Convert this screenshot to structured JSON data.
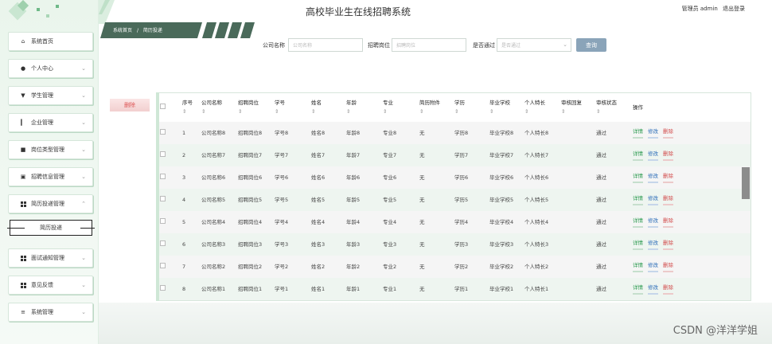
{
  "app": {
    "title": "高校毕业生在线招聘系统"
  },
  "header": {
    "user_text": "管理员 admin",
    "logout": "退出登录"
  },
  "breadcrumb": {
    "home": "系统首页",
    "sep": "/",
    "current": "简历投递"
  },
  "sidebar": {
    "items": [
      {
        "label": "系统首页",
        "icon": "home-icon"
      },
      {
        "label": "个人中心",
        "icon": "user-icon"
      },
      {
        "label": "学生管理",
        "icon": "student-icon"
      },
      {
        "label": "企业管理",
        "icon": "bar-chart-icon"
      },
      {
        "label": "岗位类型管理",
        "icon": "book-icon"
      },
      {
        "label": "招聘信息管理",
        "icon": "clipboard-icon"
      },
      {
        "label": "简历投递管理",
        "icon": "grid-icon"
      },
      {
        "label": "面试通知管理",
        "icon": "grid-icon"
      },
      {
        "label": "意见反馈",
        "icon": "grid-icon"
      },
      {
        "label": "系统管理",
        "icon": "sliders-icon"
      }
    ],
    "sub_item": "简历投递"
  },
  "search": {
    "company_label": "公司名称",
    "company_placeholder": "公司名称",
    "position_label": "招聘岗位",
    "position_placeholder": "招聘岗位",
    "approved_label": "是否通过",
    "approved_placeholder": "是否通过",
    "query_button": "查询"
  },
  "delete_button": "删除",
  "table": {
    "headers": [
      "序号",
      "公司名称",
      "招聘岗位",
      "学号",
      "姓名",
      "年龄",
      "专业",
      "简历附件",
      "学历",
      "毕业学校",
      "个人特长",
      "审核回复",
      "审核状态",
      "操作"
    ],
    "sort_symbol": "⇕",
    "actions": {
      "detail": "详情",
      "edit": "修改",
      "delete": "删除"
    },
    "rows": [
      {
        "no": "1",
        "company": "公司名称8",
        "position": "招聘岗位8",
        "student_id": "学号8",
        "name": "姓名8",
        "age": "年龄8",
        "major": "专业8",
        "attachment": "无",
        "education": "学历8",
        "school": "毕业学校8",
        "specialty": "个人特长8",
        "reply": "",
        "status": "通过"
      },
      {
        "no": "2",
        "company": "公司名称7",
        "position": "招聘岗位7",
        "student_id": "学号7",
        "name": "姓名7",
        "age": "年龄7",
        "major": "专业7",
        "attachment": "无",
        "education": "学历7",
        "school": "毕业学校7",
        "specialty": "个人特长7",
        "reply": "",
        "status": "通过"
      },
      {
        "no": "3",
        "company": "公司名称6",
        "position": "招聘岗位6",
        "student_id": "学号6",
        "name": "姓名6",
        "age": "年龄6",
        "major": "专业6",
        "attachment": "无",
        "education": "学历6",
        "school": "毕业学校6",
        "specialty": "个人特长6",
        "reply": "",
        "status": "通过"
      },
      {
        "no": "4",
        "company": "公司名称5",
        "position": "招聘岗位5",
        "student_id": "学号5",
        "name": "姓名5",
        "age": "年龄5",
        "major": "专业5",
        "attachment": "无",
        "education": "学历5",
        "school": "毕业学校5",
        "specialty": "个人特长5",
        "reply": "",
        "status": "通过"
      },
      {
        "no": "5",
        "company": "公司名称4",
        "position": "招聘岗位4",
        "student_id": "学号4",
        "name": "姓名4",
        "age": "年龄4",
        "major": "专业4",
        "attachment": "无",
        "education": "学历4",
        "school": "毕业学校4",
        "specialty": "个人特长4",
        "reply": "",
        "status": "通过"
      },
      {
        "no": "6",
        "company": "公司名称3",
        "position": "招聘岗位3",
        "student_id": "学号3",
        "name": "姓名3",
        "age": "年龄3",
        "major": "专业3",
        "attachment": "无",
        "education": "学历3",
        "school": "毕业学校3",
        "specialty": "个人特长3",
        "reply": "",
        "status": "通过"
      },
      {
        "no": "7",
        "company": "公司名称2",
        "position": "招聘岗位2",
        "student_id": "学号2",
        "name": "姓名2",
        "age": "年龄2",
        "major": "专业2",
        "attachment": "无",
        "education": "学历2",
        "school": "毕业学校2",
        "specialty": "个人特长2",
        "reply": "",
        "status": "通过"
      },
      {
        "no": "8",
        "company": "公司名称1",
        "position": "招聘岗位1",
        "student_id": "学号1",
        "name": "姓名1",
        "age": "年龄1",
        "major": "专业1",
        "attachment": "无",
        "education": "学历1",
        "school": "毕业学校1",
        "specialty": "个人特长1",
        "reply": "",
        "status": "通过"
      }
    ]
  },
  "watermark": "CSDN @洋洋学姐"
}
